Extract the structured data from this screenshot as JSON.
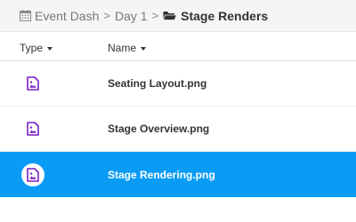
{
  "breadcrumb": {
    "items": [
      {
        "label": "Event Dash",
        "icon": "calendar-icon"
      },
      {
        "label": "Day 1"
      },
      {
        "label": "Stage Renders",
        "icon": "folder-open-icon",
        "current": true
      }
    ],
    "separator": ">"
  },
  "table": {
    "columns": [
      {
        "label": "Type",
        "sort": "chevron-down-icon"
      },
      {
        "label": "Name",
        "sort": "chevron-down-icon"
      }
    ],
    "rows": [
      {
        "name": "Seating Layout.png",
        "type_icon": "image-file-icon",
        "selected": false
      },
      {
        "name": "Stage Overview.png",
        "type_icon": "image-file-icon",
        "selected": false
      },
      {
        "name": "Stage Rendering.png",
        "type_icon": "image-file-icon",
        "selected": true
      }
    ]
  },
  "colors": {
    "selection": "#0a9cf5",
    "icon_purple": "#7a1fc4",
    "breadcrumb_bg": "#f5f5f5"
  }
}
